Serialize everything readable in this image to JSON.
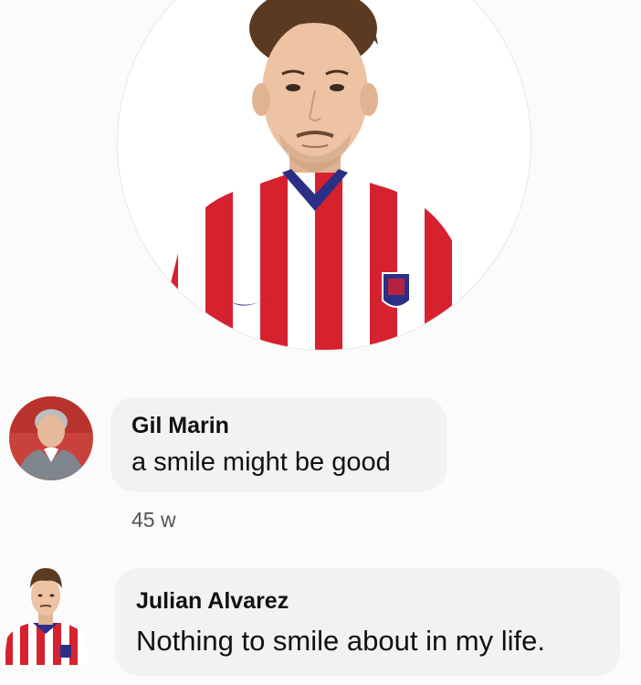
{
  "profile": {
    "photo_icon": "player-photo-red-white-striped-jersey"
  },
  "comments": [
    {
      "author": "Gil Marin",
      "text": "a smile might be good",
      "time": "45 w",
      "avatar_icon": "man-in-suit-avatar"
    },
    {
      "author": "Julian Alvarez",
      "text": "Nothing to smile about in my life.",
      "avatar_icon": "player-avatar"
    }
  ],
  "colors": {
    "jersey_red": "#d6212f",
    "jersey_white": "#ffffff",
    "jersey_collar": "#2b2f86",
    "bubble_bg": "#f1f2f4"
  }
}
